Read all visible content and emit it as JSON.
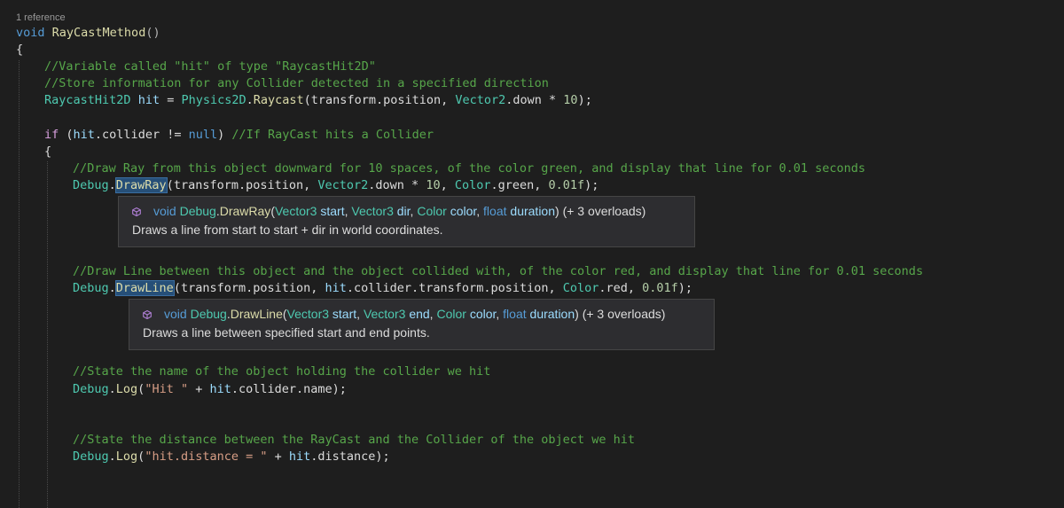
{
  "codelens": {
    "references": "1 reference"
  },
  "code": {
    "method_kw": "void",
    "method_name": "RayCastMethod",
    "method_parens": "()",
    "open_brace": "{",
    "comment1": "//Variable called \"hit\" of type \"RaycastHit2D\"",
    "comment2": "//Store information for any Collider detected in a specified direction",
    "decl_type": "RaycastHit2D",
    "decl_var": "hit",
    "decl_eq": " = ",
    "decl_class": "Physics2D",
    "decl_dot": ".",
    "decl_method": "Raycast",
    "decl_args_a": "(transform.position, ",
    "decl_vec": "Vector2",
    "decl_args_b": ".down * ",
    "decl_num": "10",
    "decl_end": ");",
    "if_kw": "if",
    "if_a": " (",
    "if_var": "hit",
    "if_b": ".collider != ",
    "if_null": "null",
    "if_c": ") ",
    "if_comment": "//If RayCast hits a Collider",
    "if_brace": "{",
    "comment3": "//Draw Ray from this object downward for 10 spaces, of the color green, and display that line for 0.01 seconds",
    "ray_class": "Debug",
    "ray_dot": ".",
    "ray_method": "DrawRay",
    "ray_a": "(transform.position, ",
    "ray_vec": "Vector2",
    "ray_b": ".down * ",
    "ray_num": "10",
    "ray_c": ", ",
    "ray_color": "Color",
    "ray_d": ".green, ",
    "ray_f": "0.01f",
    "ray_end": ");",
    "comment4": "//Draw Line between this object and the object collided with, of the color red, and display that line for 0.01 seconds",
    "line_class": "Debug",
    "line_dot": ".",
    "line_method": "DrawLine",
    "line_a": "(transform.position, ",
    "line_var": "hit",
    "line_b": ".collider.transform.position, ",
    "line_color": "Color",
    "line_c": ".red, ",
    "line_f": "0.01f",
    "line_end": ");",
    "comment5": "//State the name of the object holding the collider we hit",
    "log1_class": "Debug",
    "log1_dot": ".",
    "log1_method": "Log",
    "log1_a": "(",
    "log1_str": "\"Hit \"",
    "log1_b": " + ",
    "log1_var": "hit",
    "log1_end": ".collider.name);",
    "comment6": "//State the distance between the RayCast and the Collider of the object we hit",
    "log2_class": "Debug",
    "log2_dot": ".",
    "log2_method": "Log",
    "log2_a": "(",
    "log2_str": "\"hit.distance = \"",
    "log2_b": " + ",
    "log2_var": "hit",
    "log2_end": ".distance);"
  },
  "tooltip_drawray": {
    "kw": "void",
    "cls": "Debug",
    "dot": ".",
    "name": "DrawRay",
    "open": "(",
    "p1type": "Vector3",
    "p1": "start",
    "sep1": ", ",
    "p2type": "Vector3",
    "p2": "dir",
    "sep2": ", ",
    "p3type": "Color",
    "p3": "color",
    "sep3": ", ",
    "p4type": "float",
    "p4": "duration",
    "close": ")",
    "overloads": "(+ 3 overloads)",
    "description": "Draws a line from start to start + dir in world coordinates."
  },
  "tooltip_drawline": {
    "kw": "void",
    "cls": "Debug",
    "dot": ".",
    "name": "DrawLine",
    "open": "(",
    "p1type": "Vector3",
    "p1": "start",
    "sep1": ", ",
    "p2type": "Vector3",
    "p2": "end",
    "sep2": ", ",
    "p3type": "Color",
    "p3": "color",
    "sep3": ", ",
    "p4type": "float",
    "p4": "duration",
    "close": ")",
    "overloads": "(+ 3 overloads)",
    "description": "Draws a line between specified start and end points."
  },
  "icons": {
    "member": "method-cube-icon"
  },
  "colors": {
    "background": "#1e1e1e",
    "keyword": "#569cd6",
    "method": "#dcdcaa",
    "type": "#4ec9b0",
    "comment": "#57a64a",
    "variable": "#9cdcfe",
    "number": "#b5cea8",
    "string": "#d69d85",
    "tooltip_bg": "#2d2d30"
  }
}
